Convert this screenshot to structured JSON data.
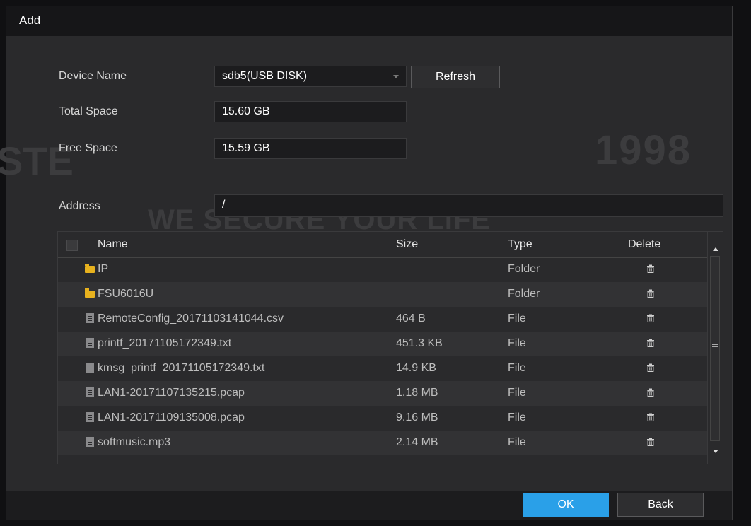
{
  "dialog": {
    "title": "Add"
  },
  "watermark": {
    "left": "STE",
    "right": "1998",
    "center": "WE SECURE YOUR LIFE"
  },
  "form": {
    "device_name_label": "Device Name",
    "device_name_value": "sdb5(USB DISK)",
    "refresh_label": "Refresh",
    "total_space_label": "Total Space",
    "total_space_value": "15.60 GB",
    "free_space_label": "Free Space",
    "free_space_value": "15.59 GB",
    "address_label": "Address",
    "address_value": "/"
  },
  "table": {
    "headers": {
      "name": "Name",
      "size": "Size",
      "type": "Type",
      "delete": "Delete"
    },
    "rows": [
      {
        "icon": "folder-icon",
        "name": "IP",
        "size": "",
        "type": "Folder"
      },
      {
        "icon": "folder-icon",
        "name": "FSU6016U",
        "size": "",
        "type": "Folder"
      },
      {
        "icon": "file-icon",
        "name": "RemoteConfig_20171103141044.csv",
        "size": "464 B",
        "type": "File"
      },
      {
        "icon": "file-icon",
        "name": "printf_20171105172349.txt",
        "size": "451.3 KB",
        "type": "File"
      },
      {
        "icon": "file-icon",
        "name": "kmsg_printf_20171105172349.txt",
        "size": "14.9 KB",
        "type": "File"
      },
      {
        "icon": "file-icon",
        "name": "LAN1-20171107135215.pcap",
        "size": "1.18 MB",
        "type": "File"
      },
      {
        "icon": "file-icon",
        "name": "LAN1-20171109135008.pcap",
        "size": "9.16 MB",
        "type": "File"
      },
      {
        "icon": "file-icon",
        "name": "softmusic.mp3",
        "size": "2.14 MB",
        "type": "File"
      }
    ]
  },
  "footer": {
    "ok_label": "OK",
    "back_label": "Back"
  },
  "colors": {
    "accent": "#2aa0e8",
    "folder": "#e8b21e",
    "background": "#2a2a2c"
  }
}
